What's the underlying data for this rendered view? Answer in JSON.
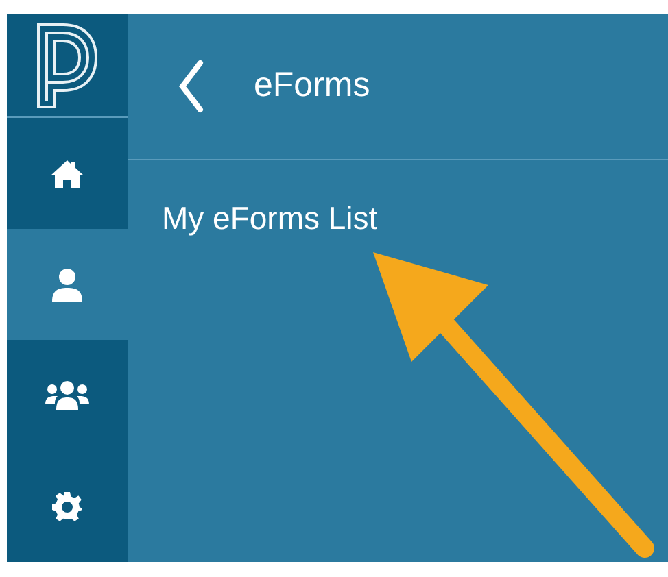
{
  "sidebar": {
    "items": [
      {
        "kind": "home",
        "selected": false
      },
      {
        "kind": "person",
        "selected": true
      },
      {
        "kind": "group",
        "selected": false
      },
      {
        "kind": "settings",
        "selected": false
      }
    ]
  },
  "header": {
    "title": "eForms"
  },
  "menu": {
    "items": [
      {
        "label": "My eForms List"
      }
    ]
  }
}
